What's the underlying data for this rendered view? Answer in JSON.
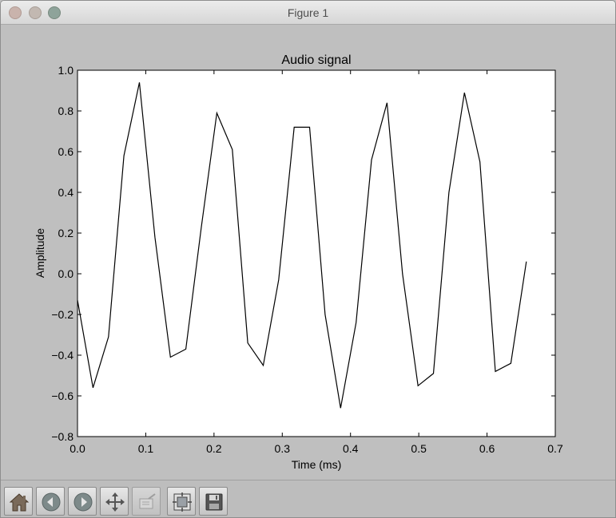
{
  "window": {
    "title": "Figure 1"
  },
  "chart_data": {
    "type": "line",
    "title": "Audio signal",
    "xlabel": "Time (ms)",
    "ylabel": "Amplitude",
    "xlim": [
      0.0,
      0.7
    ],
    "ylim": [
      -0.8,
      1.0
    ],
    "xticks": [
      "0.0",
      "0.1",
      "0.2",
      "0.3",
      "0.4",
      "0.5",
      "0.6",
      "0.7"
    ],
    "yticks": [
      "−0.8",
      "−0.6",
      "−0.4",
      "−0.2",
      "0.0",
      "0.2",
      "0.4",
      "0.6",
      "0.8",
      "1.0"
    ],
    "grid": false,
    "line_color": "#000000",
    "series": [
      {
        "x": [
          0.0,
          0.0227,
          0.0454,
          0.068,
          0.0907,
          0.1134,
          0.1361,
          0.1587,
          0.1814,
          0.2041,
          0.2268,
          0.2494,
          0.2721,
          0.2948,
          0.3175,
          0.3401,
          0.3628,
          0.3855,
          0.4082,
          0.4308,
          0.4535,
          0.4762,
          0.4989,
          0.5215,
          0.5442,
          0.5669,
          0.5896,
          0.6122,
          0.6349,
          0.6576
        ],
        "y": [
          -0.13,
          -0.56,
          -0.31,
          0.58,
          0.94,
          0.18,
          -0.41,
          -0.37,
          0.23,
          0.79,
          0.61,
          -0.34,
          -0.45,
          -0.03,
          0.72,
          0.72,
          -0.2,
          -0.66,
          -0.24,
          0.56,
          0.84,
          0.0,
          -0.55,
          -0.49,
          0.4,
          0.89,
          0.55,
          -0.48,
          -0.44,
          0.06
        ]
      }
    ]
  },
  "toolbar": {
    "tools": [
      {
        "icon": "home-icon",
        "enabled": true
      },
      {
        "icon": "back-icon",
        "enabled": true
      },
      {
        "icon": "forward-icon",
        "enabled": true
      },
      {
        "icon": "pan-icon",
        "enabled": true
      },
      {
        "icon": "zoom-icon",
        "enabled": false
      },
      {
        "icon": "subplots-icon",
        "enabled": true
      },
      {
        "icon": "save-icon",
        "enabled": true
      }
    ]
  }
}
